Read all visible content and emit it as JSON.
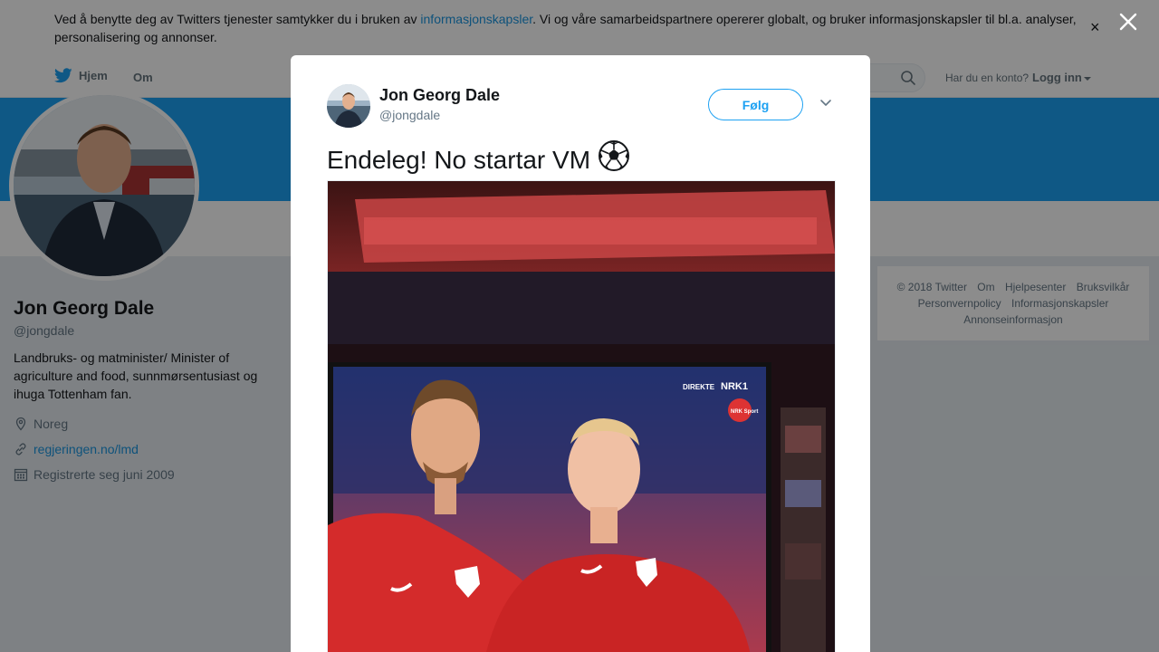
{
  "cookie_banner": {
    "text_before": "Ved å benytte deg av Twitters tjenester samtykker du i bruken av ",
    "link": "informasjonskapsler",
    "text_after": ". Vi og våre samarbeidspartnere opererer globalt, og bruker informasjonskapsler til bl.a. analyser, personalisering og annonser.",
    "close": "×"
  },
  "nav": {
    "home": "Hjem",
    "about": "Om",
    "search_placeholder": "",
    "account_question": "Har du en konto?",
    "login": "Logg inn"
  },
  "profile": {
    "name": "Jon Georg Dale",
    "handle": "@jongdale",
    "bio": "Landbruks- og matminister/ Minister of agriculture and food, sunnmørsentusiast og ihuga Tottenham fan.",
    "location": "Noreg",
    "url": "regjeringen.no/lmd",
    "joined": "Registrerte seg juni 2009"
  },
  "footer": {
    "links": [
      "© 2018 Twitter",
      "Om",
      "Hjelpesenter",
      "Bruksvilkår",
      "Personvernpolicy",
      "Informasjonskapsler",
      "Annonseinformasjon"
    ]
  },
  "modal": {
    "name": "Jon Georg Dale",
    "handle": "@jongdale",
    "follow": "Følg",
    "tweet_text": "Endeleg! No startar VM",
    "tweet_emoji": "⚽"
  },
  "media": {
    "tv_channel": "DIREKTE",
    "tv_logo": "NRK1",
    "tv_badge": "NRK Sport"
  },
  "colors": {
    "twitter_blue": "#1da1f2",
    "link_blue": "#1b95e0"
  }
}
